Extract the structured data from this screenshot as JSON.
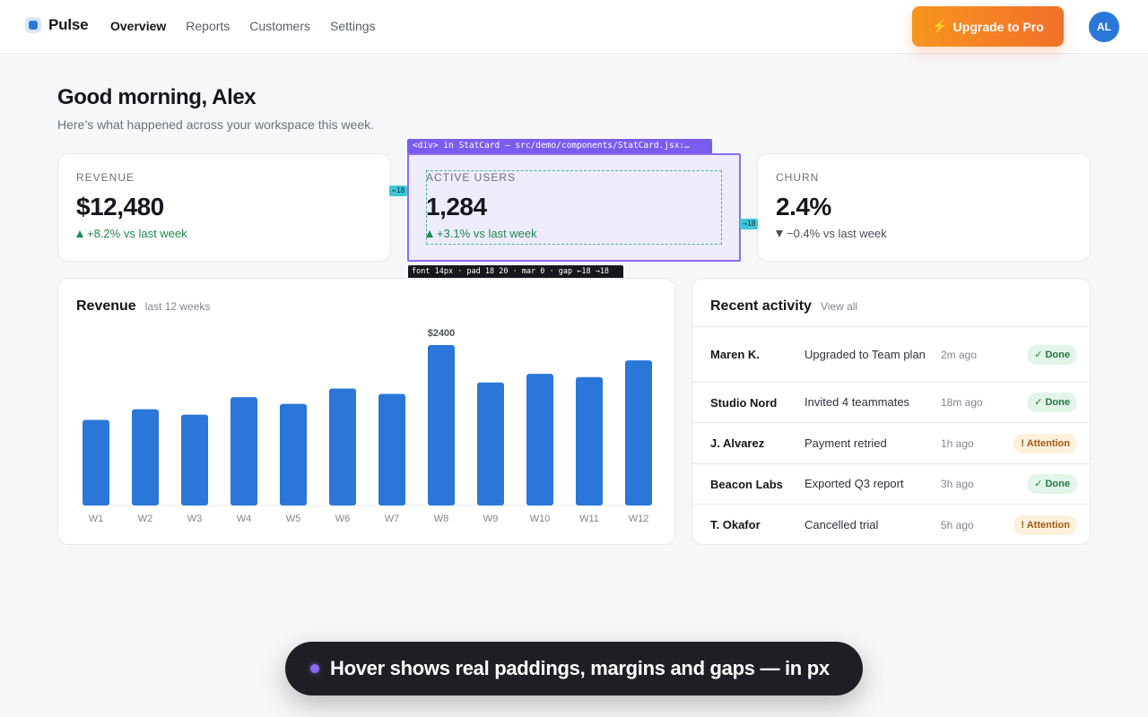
{
  "nav": {
    "brand": "Pulse",
    "links": [
      "Overview",
      "Reports",
      "Customers",
      "Settings"
    ],
    "active": "Overview",
    "upgrade_label": "Upgrade to Pro",
    "upgrade_icon": "⚡",
    "avatar_initials": "AL"
  },
  "header": {
    "greeting": "Good morning, Alex",
    "subtitle": "Here’s what happened across your workspace this week."
  },
  "stats": [
    {
      "label": "REVENUE",
      "value": "$12,480",
      "delta": "+8.2% vs last week",
      "trend": "up"
    },
    {
      "label": "ACTIVE USERS",
      "value": "1,284",
      "delta": "+3.1% vs last week",
      "trend": "up"
    },
    {
      "label": "CHURN",
      "value": "2.4%",
      "delta": "−0.4% vs last week",
      "trend": "down"
    }
  ],
  "inspector": {
    "tag": "<div> in StatCard — src/demo/components/StatCard.jsx:…",
    "metrics": "font 14px · pad 18 20 · mar 0 · gap ←18 →18",
    "gap_left": "←18",
    "gap_right": "→18"
  },
  "chart_panel": {
    "title": "Revenue",
    "subtitle": "last 12 weeks"
  },
  "chart_data": {
    "type": "bar",
    "categories": [
      "W1",
      "W2",
      "W3",
      "W4",
      "W5",
      "W6",
      "W7",
      "W8",
      "W9",
      "W10",
      "W11",
      "W12"
    ],
    "values": [
      1280,
      1440,
      1360,
      1620,
      1520,
      1750,
      1670,
      2400,
      1840,
      1970,
      1920,
      2170
    ],
    "annotation": {
      "category": "W8",
      "label": "$2400"
    },
    "ylim": [
      0,
      2400
    ],
    "color": "#2a77d9",
    "grid": false
  },
  "activity": {
    "title": "Recent activity",
    "view_all": "View all",
    "rows": [
      {
        "name": "Maren K.",
        "desc": "Upgraded to Team plan",
        "time": "2m ago",
        "status": "✓ Done",
        "kind": "done"
      },
      {
        "name": "Studio Nord",
        "desc": "Invited 4 teammates",
        "time": "18m ago",
        "status": "✓ Done",
        "kind": "done"
      },
      {
        "name": "J. Alvarez",
        "desc": "Payment retried",
        "time": "1h ago",
        "status": "! Attention",
        "kind": "attention"
      },
      {
        "name": "Beacon Labs",
        "desc": "Exported Q3 report",
        "time": "3h ago",
        "status": "✓ Done",
        "kind": "done"
      },
      {
        "name": "T. Okafor",
        "desc": "Cancelled trial",
        "time": "5h ago",
        "status": "! Attention",
        "kind": "attention"
      }
    ]
  },
  "toast": {
    "text": "Hover shows real paddings, margins and gaps — in px"
  }
}
